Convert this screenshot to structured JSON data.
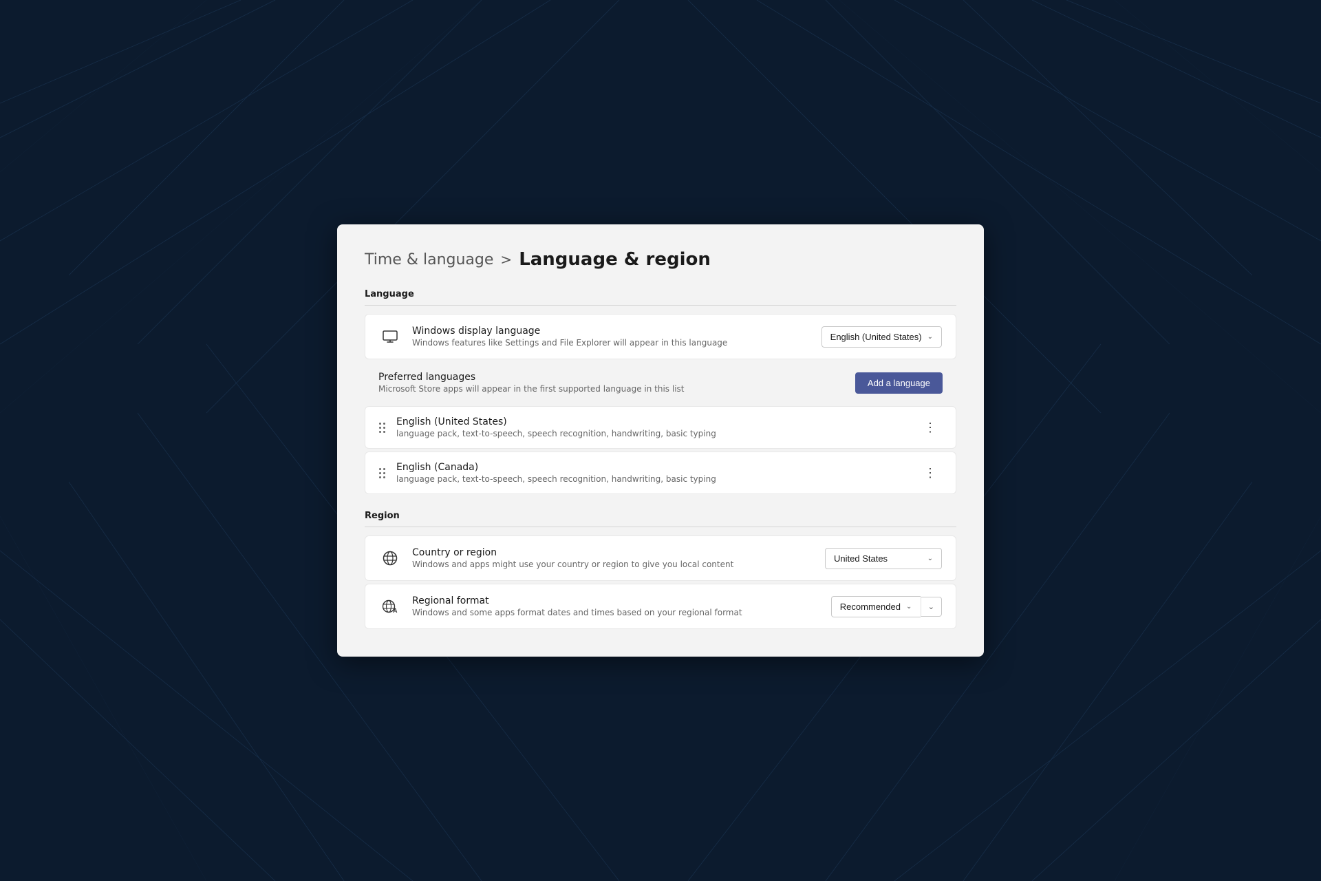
{
  "background": {
    "color": "#0d1b2e"
  },
  "breadcrumb": {
    "parent": "Time & language",
    "separator": ">",
    "current": "Language & region"
  },
  "language_section": {
    "label": "Language",
    "windows_display": {
      "title": "Windows display language",
      "description": "Windows features like Settings and File Explorer will appear in this language",
      "selected": "English (United States)"
    },
    "preferred_languages": {
      "title": "Preferred languages",
      "description": "Microsoft Store apps will appear in the first supported language in this list",
      "add_button": "Add a language"
    },
    "languages": [
      {
        "name": "English (United States)",
        "features": "language pack, text-to-speech, speech recognition, handwriting, basic typing"
      },
      {
        "name": "English (Canada)",
        "features": "language pack, text-to-speech, speech recognition, handwriting, basic typing"
      }
    ]
  },
  "region_section": {
    "label": "Region",
    "country": {
      "title": "Country or region",
      "description": "Windows and apps might use your country or region to give you local content",
      "selected": "United States"
    },
    "regional_format": {
      "title": "Regional format",
      "description": "Windows and some apps format dates and times based on your regional format",
      "selected": "Recommended"
    }
  }
}
